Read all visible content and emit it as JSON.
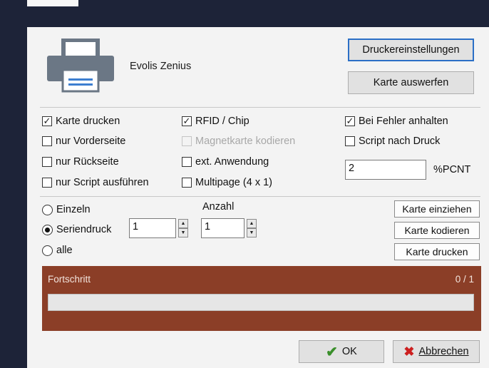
{
  "printer": {
    "name": "Evolis Zenius",
    "icon": "printer-icon"
  },
  "buttons": {
    "printer_settings": "Druckereinstellungen",
    "eject_card": "Karte auswerfen",
    "feed_card": "Karte einziehen",
    "encode_card": "Karte kodieren",
    "print_card": "Karte drucken",
    "ok": "OK",
    "cancel": "Abbrechen"
  },
  "options": {
    "col1": [
      {
        "label": "Karte drucken",
        "checked": true,
        "enabled": true
      },
      {
        "label": "nur Vorderseite",
        "checked": false,
        "enabled": true
      },
      {
        "label": "nur Rückseite",
        "checked": false,
        "enabled": true
      },
      {
        "label": "nur Script ausführen",
        "checked": false,
        "enabled": true
      }
    ],
    "col2": [
      {
        "label": "RFID / Chip",
        "checked": true,
        "enabled": true
      },
      {
        "label": "Magnetkarte kodieren",
        "checked": false,
        "enabled": false
      },
      {
        "label": "ext. Anwendung",
        "checked": false,
        "enabled": true
      },
      {
        "label": "Multipage (4 x 1)",
        "checked": false,
        "enabled": true
      }
    ],
    "col3": [
      {
        "label": "Bei Fehler anhalten",
        "checked": true,
        "enabled": true
      },
      {
        "label": "Script nach Druck",
        "checked": false,
        "enabled": true
      }
    ],
    "pcnt_value": "2",
    "pcnt_label": "%PCNT"
  },
  "mode": {
    "radios": [
      {
        "label": "Einzeln",
        "selected": false
      },
      {
        "label": "Seriendruck",
        "selected": true
      },
      {
        "label": "alle",
        "selected": false
      }
    ],
    "serial_value": "1",
    "count_label": "Anzahl",
    "count_value": "1"
  },
  "progress": {
    "label": "Fortschritt",
    "count": "0 / 1",
    "fraction": 0
  },
  "colors": {
    "progress_panel": "#8b3e27",
    "frame": "#1d2338",
    "ok_check": "#3a8f2b",
    "cancel_x": "#cc1f1f"
  }
}
